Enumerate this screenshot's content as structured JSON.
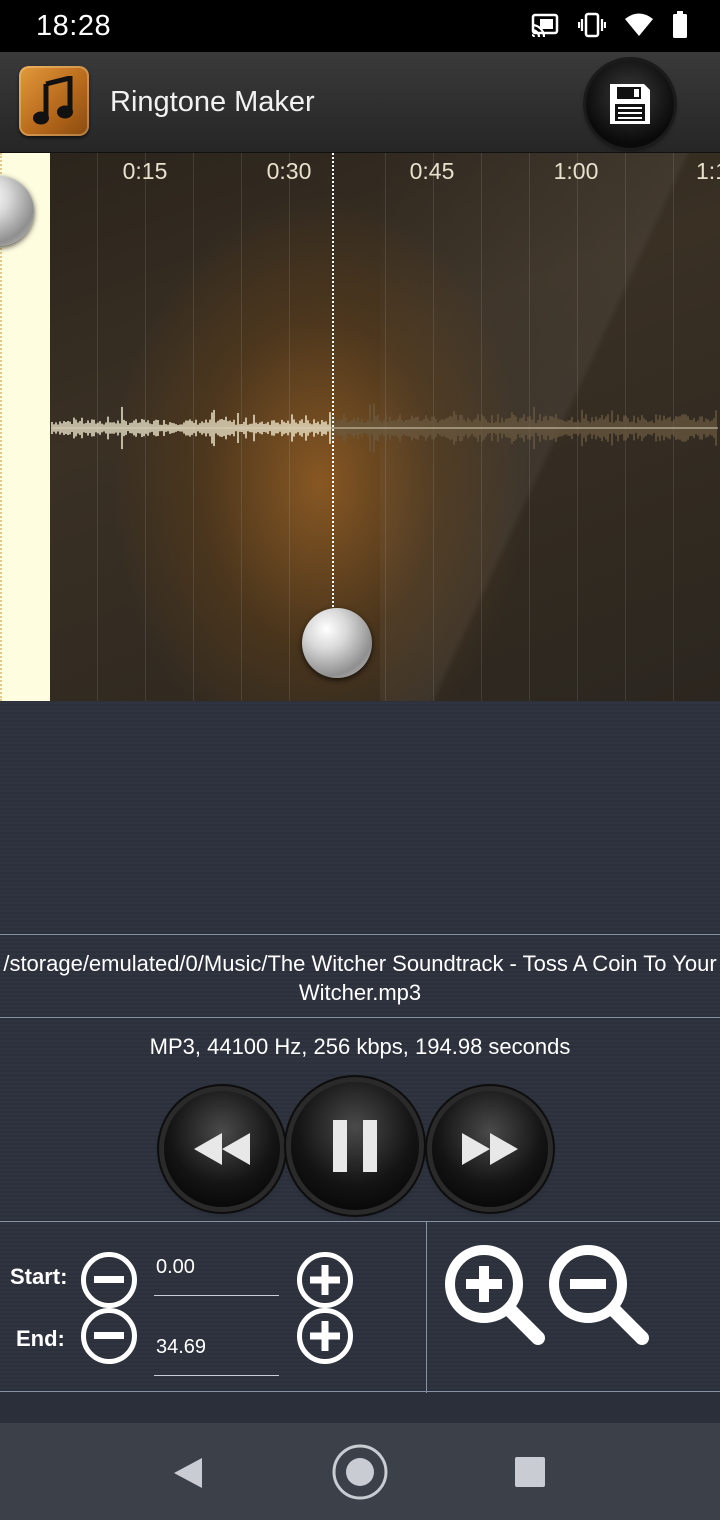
{
  "status_bar": {
    "time": "18:28",
    "icons": [
      "cast-icon",
      "vibrate-icon",
      "wifi-icon",
      "battery-icon"
    ]
  },
  "app_bar": {
    "title": "Ringtone Maker",
    "app_icon": "music-note-icon",
    "save_icon": "save-icon"
  },
  "waveform": {
    "ticks": [
      "0:15",
      "0:30",
      "0:45",
      "1:00",
      "1:1"
    ],
    "selection_start_seconds": 0.0,
    "playhead_seconds": 34.69
  },
  "file": {
    "path": "/storage/emulated/0/Music/The Witcher Soundtrack - Toss A Coin To Your Witcher.mp3",
    "info": "MP3, 44100 Hz, 256 kbps, 194.98 seconds"
  },
  "transport": {
    "rewind_icon": "rewind-icon",
    "pause_icon": "pause-icon",
    "forward_icon": "fast-forward-icon"
  },
  "controls": {
    "start_label": "Start:",
    "end_label": "End:",
    "start_value": "0.00",
    "end_value": "34.69",
    "zoom_in_icon": "zoom-in-icon",
    "zoom_out_icon": "zoom-out-icon"
  },
  "nav": {
    "back_icon": "back-icon",
    "home_icon": "home-icon",
    "recents_icon": "recents-icon"
  },
  "colors": {
    "selection_region": "#fffde0",
    "waveform_played": "#f7f1d6",
    "waveform_unplayed": "#6b5a40",
    "app_icon": "#c97a26"
  }
}
